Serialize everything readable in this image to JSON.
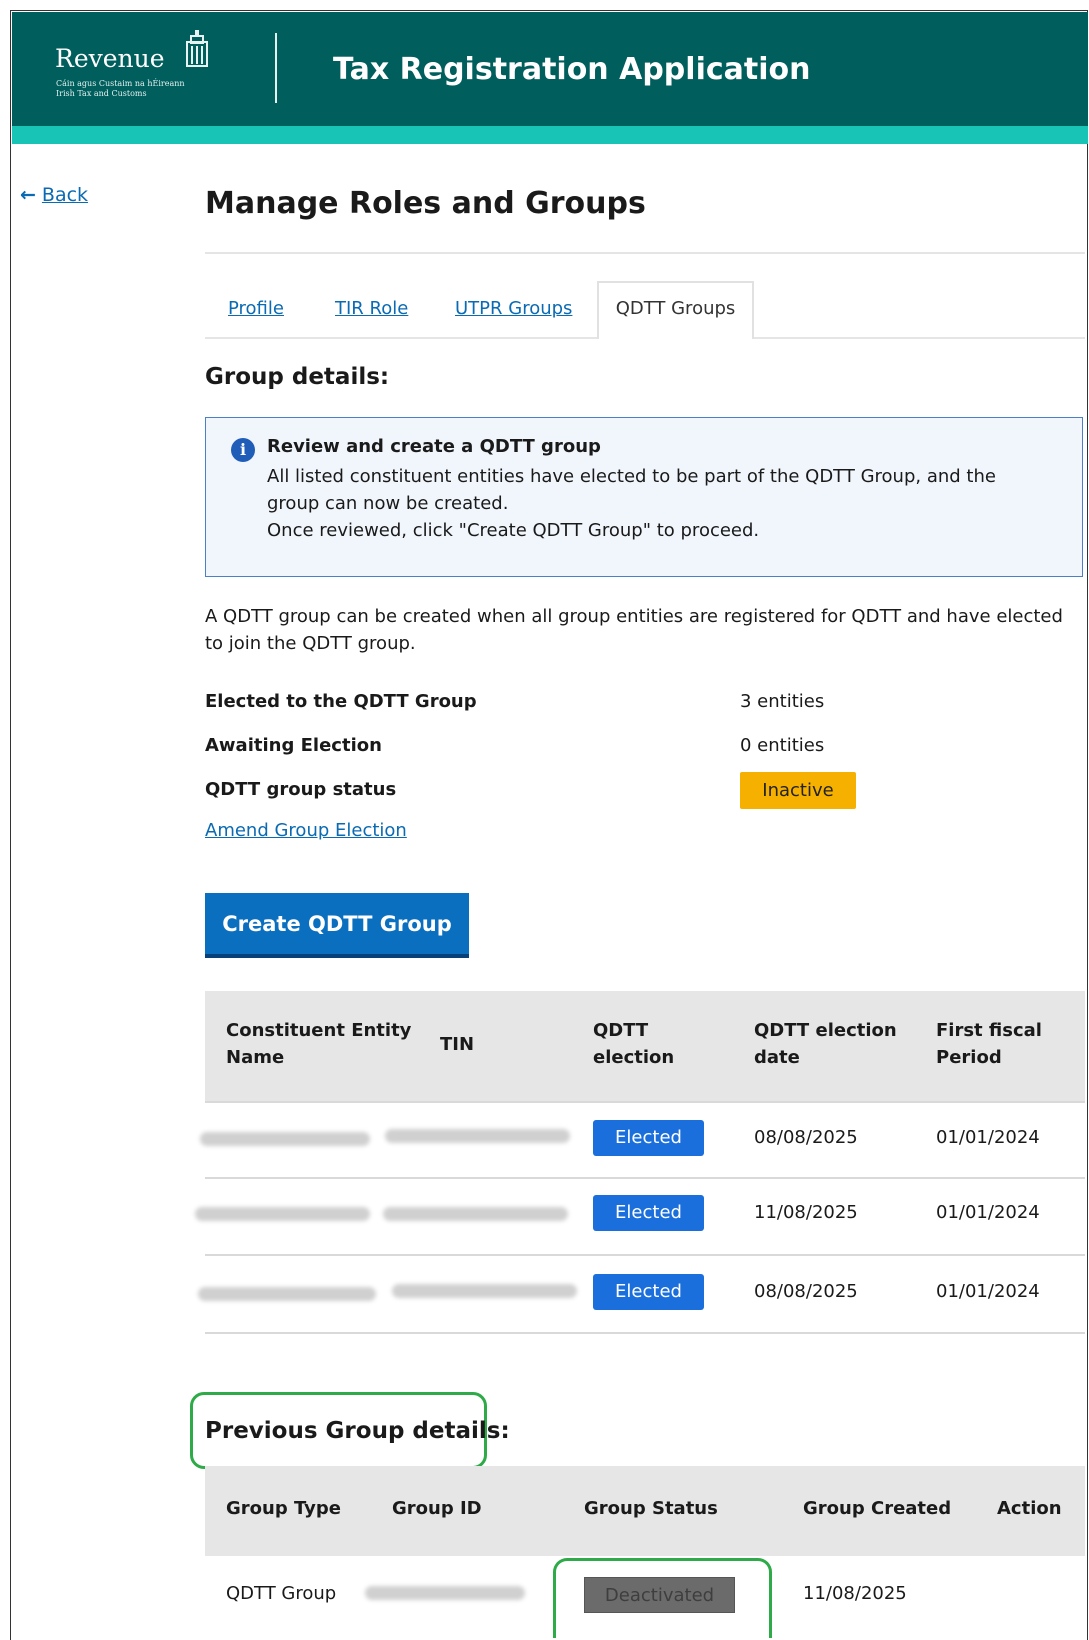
{
  "header": {
    "logo_text": "Revenue",
    "logo_subtitle_line1": "Cáin agus Custaim na hÉireann",
    "logo_subtitle_line2": "Irish Tax and Customs",
    "app_title": "Tax Registration Application",
    "colors": {
      "header_bg": "#005e5d",
      "accent": "#17c4b6"
    }
  },
  "back": {
    "label": "Back",
    "icon": "arrow-left-icon"
  },
  "page_title": "Manage Roles and Groups",
  "tabs": [
    {
      "label": "Profile",
      "active": false
    },
    {
      "label": "TIR Role",
      "active": false
    },
    {
      "label": "UTPR Groups",
      "active": false
    },
    {
      "label": "QDTT Groups",
      "active": true
    }
  ],
  "group_details": {
    "heading": "Group details:",
    "info": {
      "icon": "info-icon",
      "title": "Review and create a QDTT group",
      "line1": "All listed constituent entities have elected to be part of the QDTT Group, and the group can now be created.",
      "line2": "Once reviewed, click \"Create QDTT Group\" to proceed."
    },
    "description": "A QDTT group can be created when all group entities are registered for QDTT and have elected to join the QDTT group.",
    "summary": {
      "elected_label": "Elected to the QDTT Group",
      "elected_value": "3 entities",
      "awaiting_label": "Awaiting Election",
      "awaiting_value": "0 entities",
      "status_label": "QDTT group status",
      "status_value": "Inactive",
      "status_color": "#f6b100"
    },
    "amend_link": "Amend Group Election",
    "create_button": "Create QDTT Group"
  },
  "entities_table": {
    "headers": {
      "name_line1": "Constituent Entity",
      "name_line2": "Name",
      "tin": "TIN",
      "election_line1": "QDTT",
      "election_line2": "election",
      "date_line1": "QDTT election",
      "date_line2": "date",
      "fiscal_line1": "First fiscal",
      "fiscal_line2": "Period"
    },
    "rows": [
      {
        "election": "Elected",
        "election_date": "08/08/2025",
        "first_fiscal": "01/01/2024"
      },
      {
        "election": "Elected",
        "election_date": "11/08/2025",
        "first_fiscal": "01/01/2024"
      },
      {
        "election": "Elected",
        "election_date": "08/08/2025",
        "first_fiscal": "01/01/2024"
      }
    ],
    "elected_color": "#1a6fdc"
  },
  "previous_groups": {
    "heading": "Previous Group details:",
    "headers": {
      "type": "Group Type",
      "id": "Group ID",
      "status": "Group Status",
      "created": "Group Created",
      "action": "Action"
    },
    "rows": [
      {
        "type": "QDTT Group",
        "status": "Deactivated",
        "created": "11/08/2025"
      }
    ],
    "highlight_color": "#2eaa48"
  }
}
